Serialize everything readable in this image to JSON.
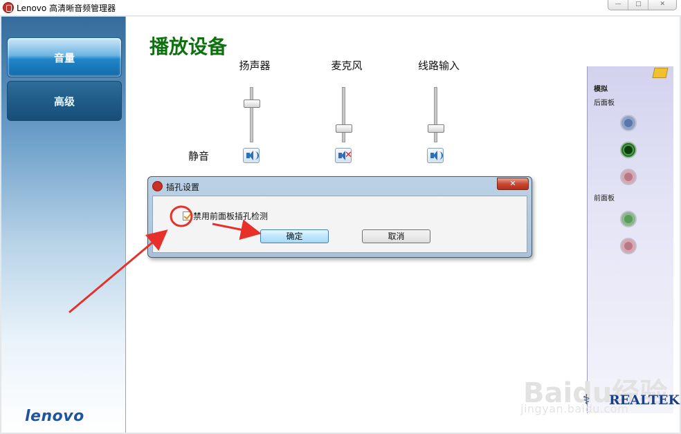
{
  "window": {
    "title": "Lenovo 高清晰音频管理器",
    "controls": [
      "—",
      "□",
      "✕"
    ]
  },
  "sidebar": {
    "items": [
      {
        "label": "音量",
        "active": true
      },
      {
        "label": "高级",
        "active": false
      }
    ],
    "brand": "lenovo"
  },
  "main": {
    "title": "播放设备",
    "channels": [
      {
        "label": "扬声器",
        "level": 0.72,
        "muted": false
      },
      {
        "label": "麦克风",
        "level": 0.22,
        "muted": true
      },
      {
        "label": "线路输入",
        "level": 0.22,
        "muted": false
      }
    ],
    "mute_label": "静音"
  },
  "jack_panel": {
    "title": "模拟",
    "rear_label": "后面板",
    "front_label": "前面板",
    "brand": "REALTEK"
  },
  "dialog": {
    "title": "插孔设置",
    "close": "✕",
    "checkbox_label": "禁用前面板插孔检测",
    "checked": true,
    "ok_label": "确定",
    "cancel_label": "取消"
  },
  "watermark": {
    "text": "Baidu经验",
    "url": "jingyan.baidu.com"
  },
  "colors": {
    "title_green": "#0f7010",
    "annotation_red": "#e8302a"
  }
}
